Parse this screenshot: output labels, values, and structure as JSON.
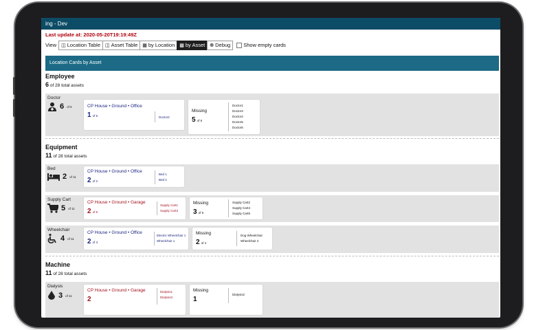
{
  "header": {
    "title": "ing - Dev",
    "last_update": "Last update at: 2020-05-20T19:19:49Z"
  },
  "view": {
    "label": "View",
    "buttons": [
      {
        "label": "Location Table",
        "icon": "table-icon",
        "active": false
      },
      {
        "label": "Asset Table",
        "icon": "table-icon",
        "active": false
      },
      {
        "label": "by Location",
        "icon": "building-icon",
        "active": false
      },
      {
        "label": "by Asset",
        "icon": "grid-icon",
        "active": true
      },
      {
        "label": "Debug",
        "icon": "bug-icon",
        "active": false
      }
    ],
    "show_empty_label": "Show empty cards"
  },
  "section_title": "Location Cards by Asset",
  "groups": [
    {
      "title": "Employee",
      "count": "6",
      "count_suffix": "of 28 total assets",
      "rows": [
        {
          "label": "Doctor",
          "icon": "doctor-icon",
          "count": "6",
          "of": "of 6",
          "cards": [
            {
              "location": "CP House • Ground • Office",
              "count": "1",
              "of": "of 6",
              "assets": [
                "Doctor2"
              ],
              "color": "blue"
            },
            {
              "missing_label": "Missing",
              "count": "5",
              "of": "of 6",
              "assets": [
                "Doctor1",
                "Doctor3",
                "Doctor4",
                "Doctor5",
                "Doctor6"
              ]
            }
          ]
        }
      ]
    },
    {
      "title": "Equipment",
      "count": "11",
      "count_suffix": "of 28 total assets",
      "rows": [
        {
          "label": "Bed",
          "icon": "bed-icon",
          "count": "2",
          "of": "of 11",
          "cards": [
            {
              "location": "CP House • Ground • Office",
              "count": "2",
              "of": "of 2",
              "assets": [
                "Bed 1",
                "Bed 2"
              ],
              "color": "blue"
            }
          ]
        },
        {
          "label": "Supply Cart",
          "icon": "cart-icon",
          "count": "5",
          "of": "of 11",
          "cards": [
            {
              "location": "CP House • Ground • Garage",
              "count": "2",
              "of": "of 5",
              "assets": [
                "Supply Cart1",
                "Supply Cart3"
              ],
              "color": "red"
            },
            {
              "missing_label": "Missing",
              "count": "3",
              "of": "of 5",
              "assets": [
                "Supply Cart2",
                "Supply Cart4",
                "Supply Cart5"
              ]
            }
          ]
        },
        {
          "label": "Wheelchair",
          "icon": "wheelchair-icon",
          "count": "4",
          "of": "of 11",
          "cards": [
            {
              "location": "CP House • Ground • Office",
              "count": "2",
              "of": "of 4",
              "assets": [
                "Electric Wheelchair 1",
                "Wheelchair 1"
              ],
              "color": "blue"
            },
            {
              "missing_label": "Missing",
              "count": "2",
              "of": "of 4",
              "assets": [
                "Dog Wheelchair",
                "Wheelchair 2"
              ]
            }
          ]
        }
      ]
    },
    {
      "title": "Machine",
      "count": "11",
      "count_suffix": "of 28 total assets",
      "rows": [
        {
          "label": "Dialysis",
          "icon": "drop-icon",
          "count": "3",
          "of": "of 11",
          "cards": [
            {
              "location": "CP House • Ground • Garage",
              "count": "2",
              "of": "",
              "assets": [
                "Dialysis1",
                "Dialysis3"
              ],
              "color": "red"
            },
            {
              "missing_label": "Missing",
              "count": "1",
              "of": "",
              "assets": [
                "Dialysis2"
              ]
            }
          ]
        }
      ]
    }
  ]
}
